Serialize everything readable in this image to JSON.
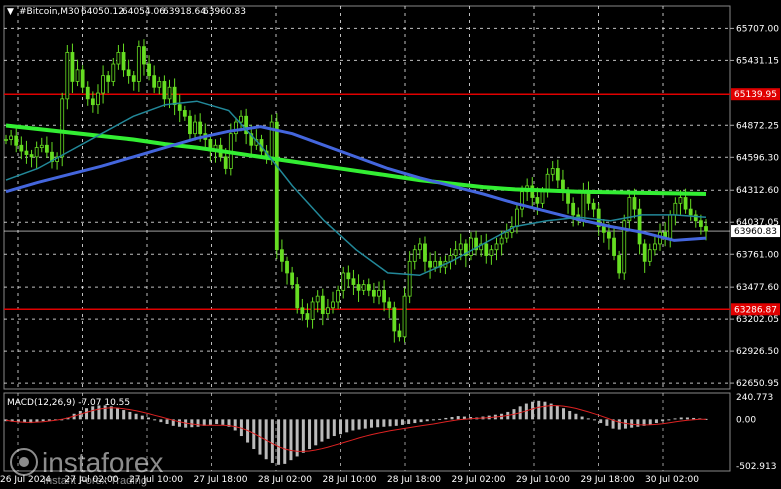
{
  "chart_data": [
    {
      "type": "candlestick",
      "title": "#Bitcoin,M30",
      "ohlc_header": {
        "open": "64050.12",
        "high": "64054.06",
        "low": "63918.64",
        "close": "63960.83"
      },
      "ylim": [
        62600,
        65900
      ],
      "y_ticks": [
        "65707.00",
        "65431.15",
        "64872.25",
        "64596.30",
        "64312.60",
        "64037.05",
        "63761.00",
        "63477.60",
        "63202.05",
        "62926.50",
        "62650.95"
      ],
      "x_ticks": [
        "26 Jul 2024",
        "27 Jul 02:00",
        "27 Jul 10:00",
        "27 Jul 18:00",
        "28 Jul 02:00",
        "28 Jul 10:00",
        "28 Jul 18:00",
        "29 Jul 02:00",
        "29 Jul 10:00",
        "29 Jul 18:00",
        "30 Jul 02:00"
      ],
      "horizontal_levels": [
        {
          "value": 65139.95,
          "label": "65139.95",
          "color": "#e00000"
        },
        {
          "value": 63286.87,
          "label": "63286.87",
          "color": "#e00000"
        },
        {
          "value": 63960.83,
          "label": "63960.83",
          "color": "#ffffff"
        }
      ],
      "candle_color": "#66dd22",
      "close_series": [
        64750,
        64780,
        64700,
        64650,
        64620,
        64600,
        64680,
        64700,
        64640,
        64560,
        64600,
        65100,
        65500,
        65250,
        65350,
        65200,
        65100,
        65050,
        65150,
        65300,
        65250,
        65400,
        65500,
        65350,
        65300,
        65250,
        65550,
        65400,
        65300,
        65200,
        65250,
        65100,
        65200,
        65050,
        65000,
        64950,
        64800,
        64900,
        64800,
        64750,
        64650,
        64700,
        64600,
        64500,
        64800,
        64900,
        64950,
        64800,
        64700,
        64750,
        64650,
        64600,
        64900,
        63800,
        63700,
        63600,
        63500,
        63300,
        63250,
        63200,
        63350,
        63400,
        63250,
        63300,
        63350,
        63450,
        63600,
        63550,
        63500,
        63450,
        63500,
        63450,
        63400,
        63450,
        63350,
        63300,
        63100,
        63050,
        63400,
        63700,
        63800,
        63850,
        63700,
        63650,
        63700,
        63650,
        63700,
        63750,
        63800,
        63850,
        63750,
        63900,
        63800,
        63850,
        63750,
        63800,
        63850,
        63900,
        63950,
        64000,
        64150,
        64300,
        64350,
        64250,
        64200,
        64300,
        64450,
        64500,
        64400,
        64300,
        64200,
        64100,
        64050,
        64300,
        64200,
        64150,
        64000,
        63950,
        63900,
        63750,
        63600,
        64050,
        64250,
        64150,
        63850,
        63700,
        63800,
        63850,
        63950,
        63900,
        64100,
        64200,
        64250,
        64150,
        64100,
        64050,
        64000,
        63960.83
      ],
      "series": [
        {
          "name": "MA-200",
          "color": "#33ee33",
          "values": [
            64870,
            64840,
            64810,
            64780,
            64750,
            64710,
            64680,
            64640,
            64600,
            64560,
            64520,
            64480,
            64440,
            64400,
            64370,
            64340,
            64320,
            64310,
            64300,
            64295,
            64290,
            64285,
            64280
          ]
        },
        {
          "name": "MA-100",
          "color": "#4466dd",
          "values": [
            64300,
            64380,
            64450,
            64520,
            64600,
            64680,
            64760,
            64820,
            64860,
            64800,
            64700,
            64600,
            64500,
            64420,
            64350,
            64280,
            64200,
            64130,
            64060,
            64000,
            63950,
            63880,
            63900
          ]
        },
        {
          "name": "MA-50",
          "color": "#228899",
          "values": [
            64400,
            64500,
            64650,
            64800,
            64950,
            65050,
            65080,
            65000,
            64700,
            64350,
            64050,
            63800,
            63600,
            63580,
            63700,
            63850,
            64000,
            64050,
            64080,
            64050,
            64100,
            64100,
            64080
          ]
        }
      ]
    },
    {
      "type": "bar",
      "title": "MACD(12,26,9) -7.07 10.55",
      "ylim": [
        -502.913,
        240.773
      ],
      "y_ticks": [
        "240.773",
        "0.00",
        "-502.913"
      ],
      "bar_color": "#bbbbbb",
      "signal_color": "#dd2222",
      "histogram": [
        -20,
        -25,
        -30,
        -35,
        -40,
        -30,
        -20,
        -15,
        -10,
        -5,
        20,
        60,
        90,
        120,
        140,
        150,
        150,
        140,
        120,
        100,
        80,
        60,
        40,
        20,
        -10,
        -30,
        -50,
        -70,
        -80,
        -90,
        -85,
        -80,
        -70,
        -60,
        -50,
        -60,
        -80,
        -120,
        -180,
        -250,
        -320,
        -380,
        -430,
        -470,
        -490,
        -480,
        -440,
        -400,
        -360,
        -320,
        -280,
        -240,
        -210,
        -180,
        -160,
        -140,
        -120,
        -110,
        -100,
        -90,
        -85,
        -80,
        -75,
        -70,
        -60,
        -50,
        -40,
        -30,
        -20,
        -10,
        5,
        15,
        25,
        35,
        30,
        25,
        20,
        30,
        40,
        50,
        60,
        80,
        110,
        140,
        170,
        190,
        200,
        190,
        170,
        150,
        120,
        90,
        60,
        30,
        10,
        -10,
        -40,
        -70,
        -100,
        -110,
        -100,
        -90,
        -80,
        -70,
        -60,
        -40,
        -20,
        0,
        10,
        20,
        20,
        15,
        10,
        5
      ],
      "signal": [
        -10,
        -20,
        -28,
        -32,
        -33,
        -30,
        -25,
        -18,
        -10,
        0,
        15,
        35,
        55,
        75,
        95,
        110,
        120,
        125,
        122,
        115,
        105,
        92,
        78,
        62,
        44,
        26,
        8,
        -10,
        -26,
        -40,
        -50,
        -58,
        -63,
        -64,
        -63,
        -64,
        -68,
        -78,
        -95,
        -120,
        -152,
        -188,
        -225,
        -262,
        -295,
        -320,
        -336,
        -344,
        -346,
        -341,
        -331,
        -316,
        -299,
        -280,
        -260,
        -240,
        -220,
        -200,
        -182,
        -165,
        -150,
        -136,
        -123,
        -112,
        -101,
        -90,
        -80,
        -70,
        -60,
        -50,
        -38,
        -26,
        -15,
        -5,
        2,
        7,
        10,
        14,
        19,
        25,
        32,
        42,
        55,
        72,
        92,
        112,
        130,
        142,
        148,
        148,
        143,
        132,
        118,
        100,
        80,
        60,
        38,
        14,
        -10,
        -30,
        -44,
        -53,
        -58,
        -60,
        -59,
        -55,
        -48,
        -38,
        -28,
        -18,
        -10,
        -4,
        0,
        2
      ]
    }
  ],
  "watermark": {
    "brand": "instaforex",
    "tagline": "Instant Forex Trading"
  }
}
